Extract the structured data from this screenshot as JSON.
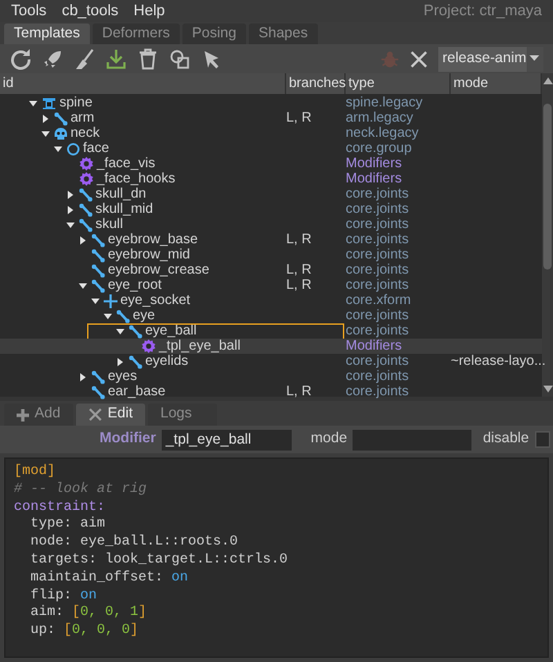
{
  "menu": [
    "Tools",
    "cb_tools",
    "Help"
  ],
  "project": "Project: ctr_maya",
  "tabs": [
    {
      "label": "Templates",
      "selected": true
    },
    {
      "label": "Deformers",
      "selected": false
    },
    {
      "label": "Posing",
      "selected": false
    },
    {
      "label": "Shapes",
      "selected": false
    }
  ],
  "toolbar": {
    "preset": "release-anim"
  },
  "columns": [
    "id",
    "branches",
    "type",
    "mode"
  ],
  "tree": [
    {
      "label": "spine",
      "kind": "rig",
      "expanded": true,
      "type": "spine.legacy",
      "children": [
        {
          "label": "arm",
          "kind": "joint",
          "expanded": false,
          "branches": "L, R",
          "type": "arm.legacy"
        },
        {
          "label": "neck",
          "kind": "head",
          "expanded": true,
          "type": "neck.legacy",
          "children": [
            {
              "label": "face",
              "kind": "group",
              "expanded": true,
              "type": "core.group",
              "children": [
                {
                  "label": "_face_vis",
                  "kind": "modifier",
                  "type": "Modifiers"
                },
                {
                  "label": "_face_hooks",
                  "kind": "modifier",
                  "type": "Modifiers"
                },
                {
                  "label": "skull_dn",
                  "kind": "joint",
                  "expanded": false,
                  "type": "core.joints"
                },
                {
                  "label": "skull_mid",
                  "kind": "joint",
                  "expanded": false,
                  "type": "core.joints"
                },
                {
                  "label": "skull",
                  "kind": "joint",
                  "expanded": true,
                  "type": "core.joints",
                  "children": [
                    {
                      "label": "eyebrow_base",
                      "kind": "joint",
                      "expanded": false,
                      "branches": "L, R",
                      "type": "core.joints"
                    },
                    {
                      "label": "eyebrow_mid",
                      "kind": "joint",
                      "type": "core.joints"
                    },
                    {
                      "label": "eyebrow_crease",
                      "kind": "joint",
                      "branches": "L, R",
                      "type": "core.joints"
                    },
                    {
                      "label": "eye_root",
                      "kind": "joint",
                      "expanded": true,
                      "branches": "L, R",
                      "type": "core.joints",
                      "children": [
                        {
                          "label": "eye_socket",
                          "kind": "xform",
                          "expanded": true,
                          "type": "core.xform",
                          "children": [
                            {
                              "label": "eye",
                              "kind": "joint",
                              "expanded": true,
                              "type": "core.joints",
                              "children": [
                                {
                                  "label": "eye_ball",
                                  "kind": "joint",
                                  "expanded": true,
                                  "outlined": true,
                                  "type": "core.joints",
                                  "children": [
                                    {
                                      "label": "_tpl_eye_ball",
                                      "kind": "modifier",
                                      "selected": true,
                                      "type": "Modifiers"
                                    }
                                  ]
                                },
                                {
                                  "label": "eyelids",
                                  "kind": "joint",
                                  "expanded": false,
                                  "type": "core.joints",
                                  "mode": "~release-layo..."
                                }
                              ]
                            }
                          ]
                        }
                      ]
                    },
                    {
                      "label": "eyes",
                      "kind": "joint",
                      "expanded": false,
                      "type": "core.joints"
                    },
                    {
                      "label": "ear_base",
                      "kind": "joint",
                      "branches": "L, R",
                      "type": "core.joints"
                    }
                  ]
                }
              ]
            }
          ]
        }
      ]
    }
  ],
  "bottom_tabs": [
    {
      "label": "Add",
      "kind": "plus",
      "selected": false
    },
    {
      "label": "Edit",
      "kind": "tools",
      "selected": true
    },
    {
      "label": "Logs",
      "selected": false
    }
  ],
  "editor": {
    "modifier_label": "Modifier",
    "modifier_value": "_tpl_eye_ball",
    "mode_label": "mode",
    "disable_label": "disable",
    "disable": false
  },
  "code": [
    [
      {
        "kind": "bracket",
        "text": "[mod]"
      }
    ],
    [
      {
        "kind": "comment",
        "text": "# -- look at rig"
      }
    ],
    [
      {
        "kind": "section",
        "text": "constraint:"
      }
    ],
    [
      {
        "kind": "key",
        "text": "  type: "
      },
      {
        "kind": "plain",
        "text": "aim"
      }
    ],
    [
      {
        "kind": "key",
        "text": "  node: "
      },
      {
        "kind": "plain",
        "text": "eye_ball.L::roots.0"
      }
    ],
    [
      {
        "kind": "key",
        "text": "  targets: "
      },
      {
        "kind": "plain",
        "text": "look_target.L::ctrls.0"
      }
    ],
    [
      {
        "kind": "key",
        "text": "  maintain_offset: "
      },
      {
        "kind": "bool",
        "text": "on"
      }
    ],
    [
      {
        "kind": "key",
        "text": "  flip: "
      },
      {
        "kind": "bool",
        "text": "on"
      }
    ],
    [
      {
        "kind": "key",
        "text": "  aim: "
      },
      {
        "kind": "bracket",
        "text": "["
      },
      {
        "kind": "number",
        "text": "0, 0, 1"
      },
      {
        "kind": "bracket",
        "text": "]"
      }
    ],
    [
      {
        "kind": "key",
        "text": "  up: "
      },
      {
        "kind": "bracket",
        "text": "["
      },
      {
        "kind": "number",
        "text": "0, 0, 0"
      },
      {
        "kind": "bracket",
        "text": "]"
      }
    ]
  ]
}
